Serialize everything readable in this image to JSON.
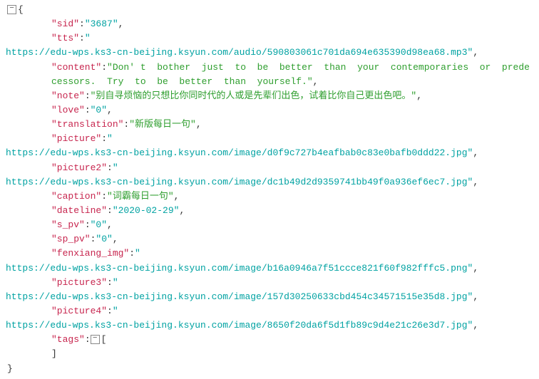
{
  "opening_brace": "{",
  "closing_brace": "}",
  "bracket_open": "[",
  "bracket_close": "]",
  "collapse_glyph": "−",
  "fields": {
    "sid": {
      "key": "\"sid\"",
      "val": "\"3687\"",
      "trail": ","
    },
    "tts": {
      "key": "\"tts\"",
      "val_prefix": "\"",
      "url": "https://edu-wps.ks3-cn-beijing.ksyun.com/audio/590803061c701da694e635390d98ea68.mp3",
      "val_suffix": "\"",
      "trail": ","
    },
    "content": {
      "key": "\"content\"",
      "val": "\"Don' t  bother  just  to  be  better  than  your  contemporaries  or  predecessors.  Try  to  be  better  than  yourself.\"",
      "trail": ","
    },
    "note": {
      "key": "\"note\"",
      "val": "\"别自寻烦恼的只想比你同时代的人或是先辈们出色，试着比你自己更出色吧。\"",
      "trail": ","
    },
    "love": {
      "key": "\"love\"",
      "val": "\"0\"",
      "trail": ","
    },
    "translation": {
      "key": "\"translation\"",
      "val": "\"新版每日一句\"",
      "trail": ","
    },
    "picture": {
      "key": "\"picture\"",
      "val_prefix": "\"",
      "url": "https://edu-wps.ks3-cn-beijing.ksyun.com/image/d0f9c727b4eafbab0c83e0bafb0ddd22.jpg",
      "val_suffix": "\"",
      "trail": ","
    },
    "picture2": {
      "key": "\"picture2\"",
      "val_prefix": "\"",
      "url": "https://edu-wps.ks3-cn-beijing.ksyun.com/image/dc1b49d2d9359741bb49f0a936ef6ec7.jpg",
      "val_suffix": "\"",
      "trail": ","
    },
    "caption": {
      "key": "\"caption\"",
      "val": "\"词霸每日一句\"",
      "trail": ","
    },
    "dateline": {
      "key": "\"dateline\"",
      "val": "\"2020-02-29\"",
      "trail": ","
    },
    "s_pv": {
      "key": "\"s_pv\"",
      "val": "\"0\"",
      "trail": ","
    },
    "sp_pv": {
      "key": "\"sp_pv\"",
      "val": "\"0\"",
      "trail": ","
    },
    "fenxiang_img": {
      "key": "\"fenxiang_img\"",
      "val_prefix": "\"",
      "url": "https://edu-wps.ks3-cn-beijing.ksyun.com/image/b16a0946a7f51ccce821f60f982fffc5.png",
      "val_suffix": "\"",
      "trail": ","
    },
    "picture3": {
      "key": "\"picture3\"",
      "val_prefix": "\"",
      "url": "https://edu-wps.ks3-cn-beijing.ksyun.com/image/157d30250633cbd454c34571515e35d8.jpg",
      "val_suffix": "\"",
      "trail": ","
    },
    "picture4": {
      "key": "\"picture4\"",
      "val_prefix": "\"",
      "url": "https://edu-wps.ks3-cn-beijing.ksyun.com/image/8650f20da6f5d1fb89c9d4e21c26e3d7.jpg",
      "val_suffix": "\"",
      "trail": ","
    },
    "tags": {
      "key": "\"tags\"",
      "trail": ""
    }
  }
}
